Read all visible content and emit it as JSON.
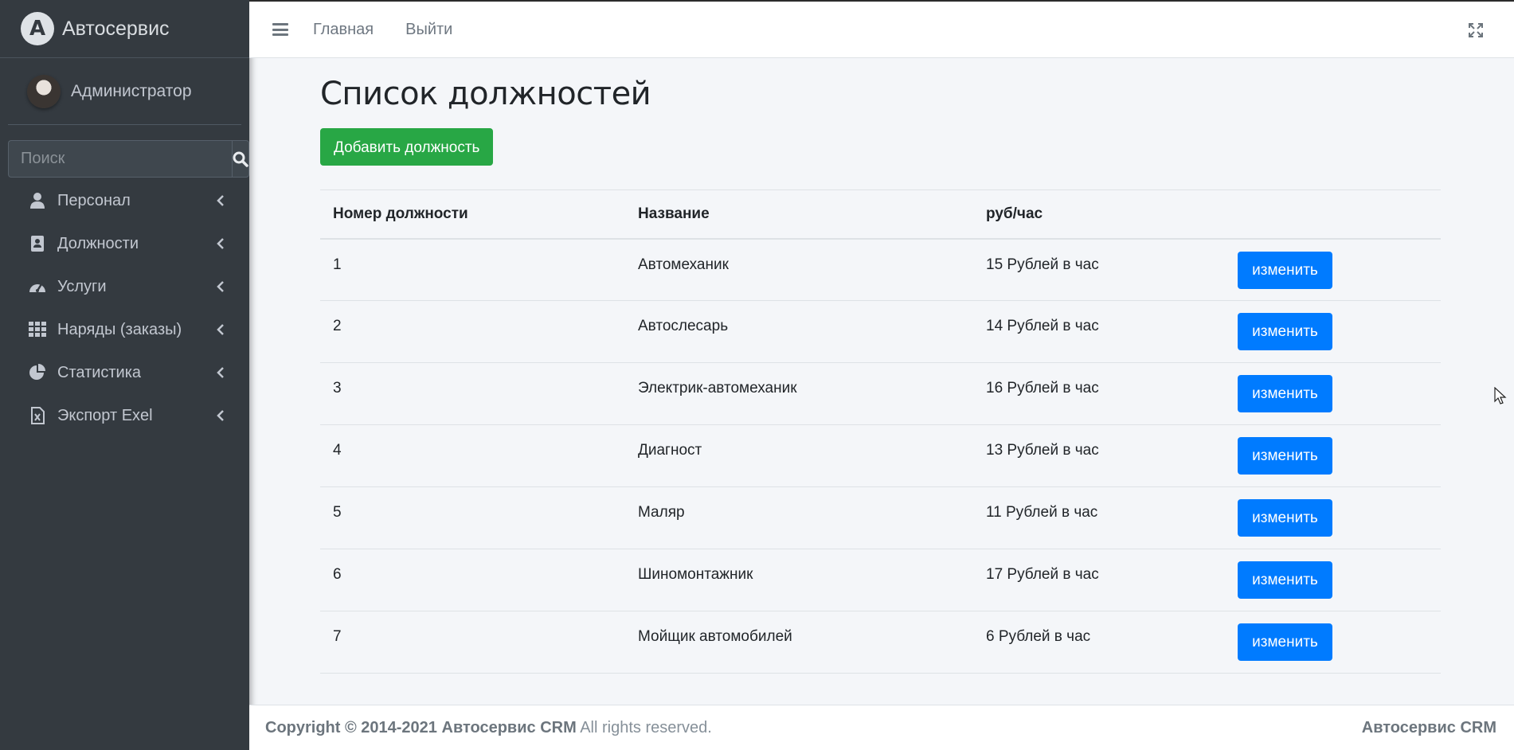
{
  "brand": {
    "logo_letter": "A",
    "name": "Автосервис"
  },
  "user": {
    "name": "Администратор"
  },
  "search": {
    "placeholder": "Поиск"
  },
  "sidebar": {
    "items": [
      {
        "label": "Персонал",
        "icon": "user-icon"
      },
      {
        "label": "Должности",
        "icon": "address-book-icon"
      },
      {
        "label": "Услуги",
        "icon": "gauge-icon"
      },
      {
        "label": "Наряды (заказы)",
        "icon": "grid-icon"
      },
      {
        "label": "Статистика",
        "icon": "pie-chart-icon"
      },
      {
        "label": "Экспорт Exel",
        "icon": "excel-file-icon"
      }
    ]
  },
  "topbar": {
    "home": "Главная",
    "logout": "Выйти"
  },
  "page": {
    "title": "Список должностей",
    "add_button": "Добавить должность",
    "edit_label": "изменить"
  },
  "table": {
    "headers": [
      "Номер должности",
      "Название",
      "руб/час",
      ""
    ],
    "rows": [
      {
        "id": "1",
        "name": "Автомеханик",
        "rate": "15 Рублей в час"
      },
      {
        "id": "2",
        "name": "Автослесарь",
        "rate": "14 Рублей в час"
      },
      {
        "id": "3",
        "name": "Электрик-автомеханик",
        "rate": "16 Рублей в час"
      },
      {
        "id": "4",
        "name": "Диагност",
        "rate": "13 Рублей в час"
      },
      {
        "id": "5",
        "name": "Маляр",
        "rate": "11 Рублей в час"
      },
      {
        "id": "6",
        "name": "Шиномонтажник",
        "rate": "17 Рублей в час"
      },
      {
        "id": "7",
        "name": "Мойщик автомобилей",
        "rate": "6 Рублей в час"
      }
    ]
  },
  "footer": {
    "copyright_prefix": "Copyright © 2014-2021",
    "company": "Автосервис CRM",
    "rights": "All rights reserved.",
    "right_text": "Автосервис CRM"
  },
  "colors": {
    "sidebar_bg": "#343a40",
    "primary": "#007bff",
    "success": "#28a745",
    "content_bg": "#f4f6f9"
  }
}
